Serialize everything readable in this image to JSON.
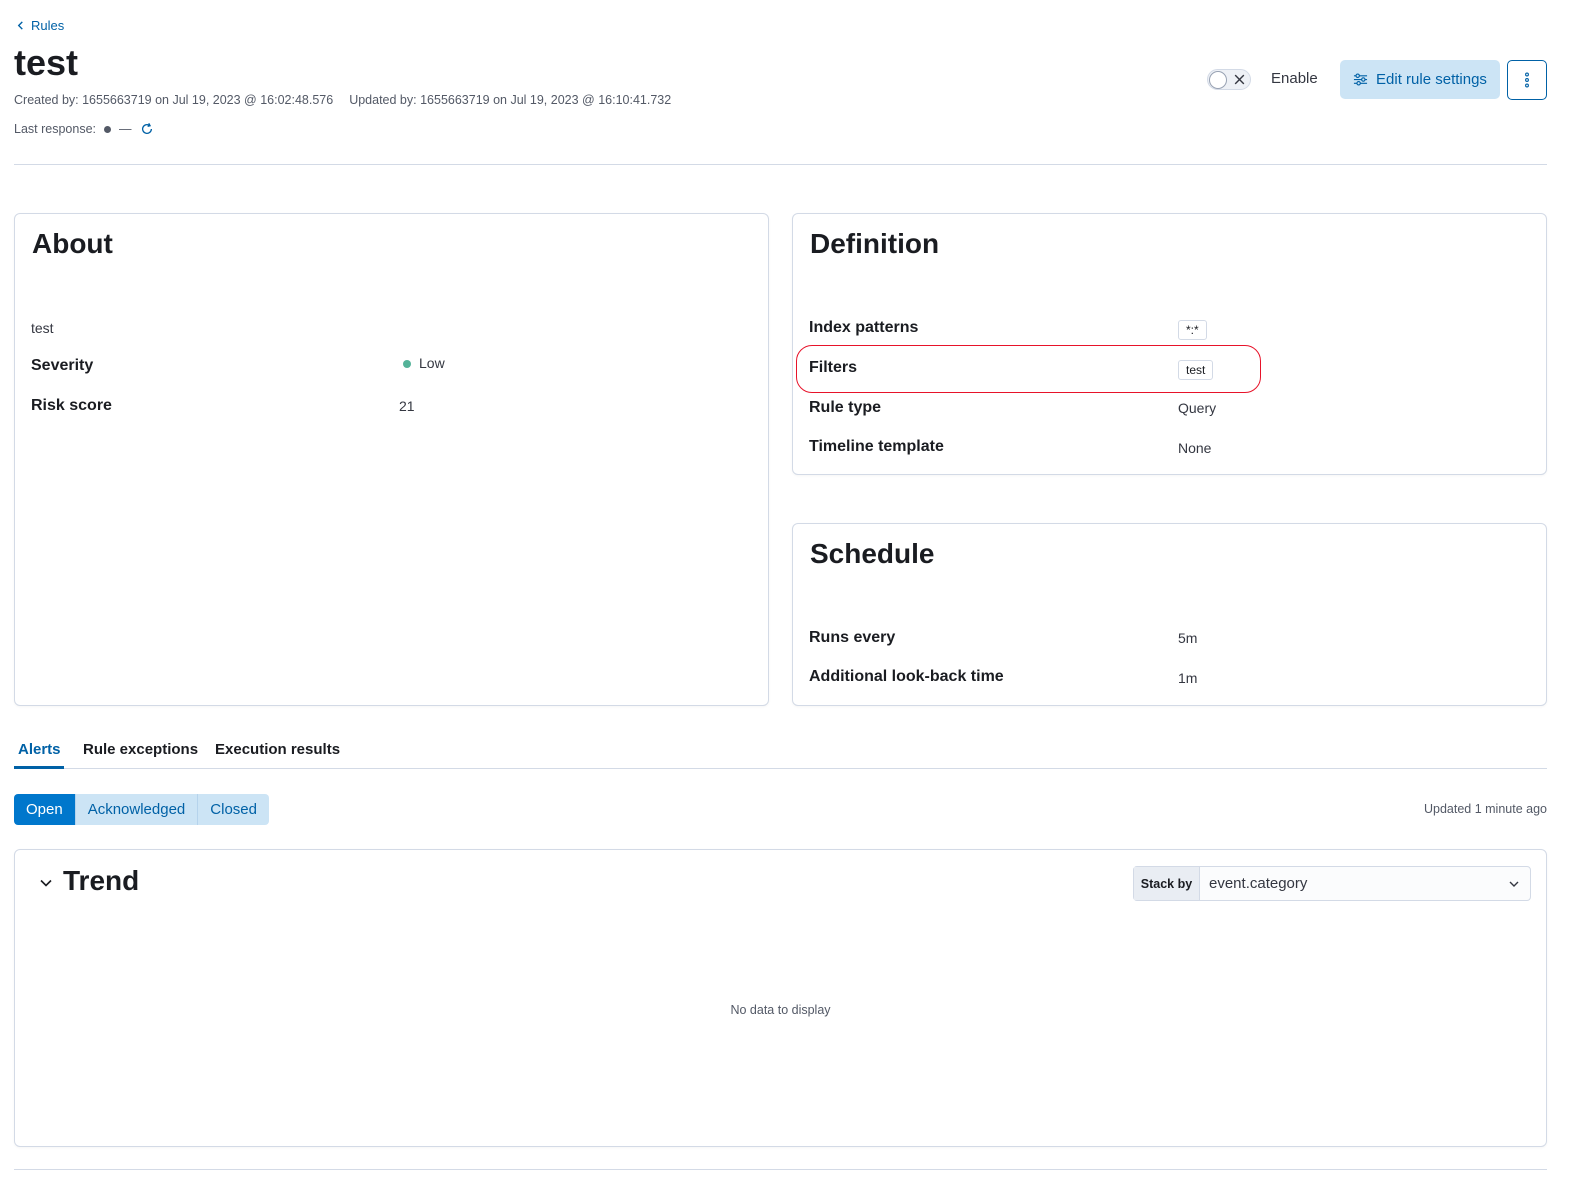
{
  "breadcrumb": {
    "back_label": "Rules"
  },
  "rule": {
    "title": "test",
    "created": "Created by: 1655663719 on Jul 19, 2023 @ 16:02:48.576",
    "updated": "Updated by: 1655663719 on Jul 19, 2023 @ 16:10:41.732",
    "last_response_label": "Last response:",
    "last_response_value": "—"
  },
  "header_actions": {
    "enable_label": "Enable",
    "enabled": false,
    "edit_label": "Edit rule settings"
  },
  "about": {
    "title": "About",
    "description": "test",
    "severity_label": "Severity",
    "severity_value": "Low",
    "risk_label": "Risk score",
    "risk_value": "21"
  },
  "definition": {
    "title": "Definition",
    "index_patterns_label": "Index patterns",
    "index_patterns_value": "*:*",
    "filters_label": "Filters",
    "filters_value": "test",
    "rule_type_label": "Rule type",
    "rule_type_value": "Query",
    "timeline_label": "Timeline template",
    "timeline_value": "None"
  },
  "schedule": {
    "title": "Schedule",
    "runs_label": "Runs every",
    "runs_value": "5m",
    "lookback_label": "Additional look-back time",
    "lookback_value": "1m"
  },
  "tabs": [
    {
      "label": "Alerts",
      "active": true
    },
    {
      "label": "Rule exceptions",
      "active": false
    },
    {
      "label": "Execution results",
      "active": false
    }
  ],
  "status_filter": {
    "options": [
      "Open",
      "Acknowledged",
      "Closed"
    ],
    "selected": "Open",
    "updated_text": "Updated 1 minute ago"
  },
  "trend": {
    "title": "Trend",
    "stack_by_label": "Stack by",
    "stack_by_value": "event.category",
    "empty_text": "No data to display"
  },
  "colors": {
    "accent": "#0061a6",
    "selected_button": "#0077cc",
    "severity_low": "#54b399",
    "highlight": "#e7132a"
  }
}
